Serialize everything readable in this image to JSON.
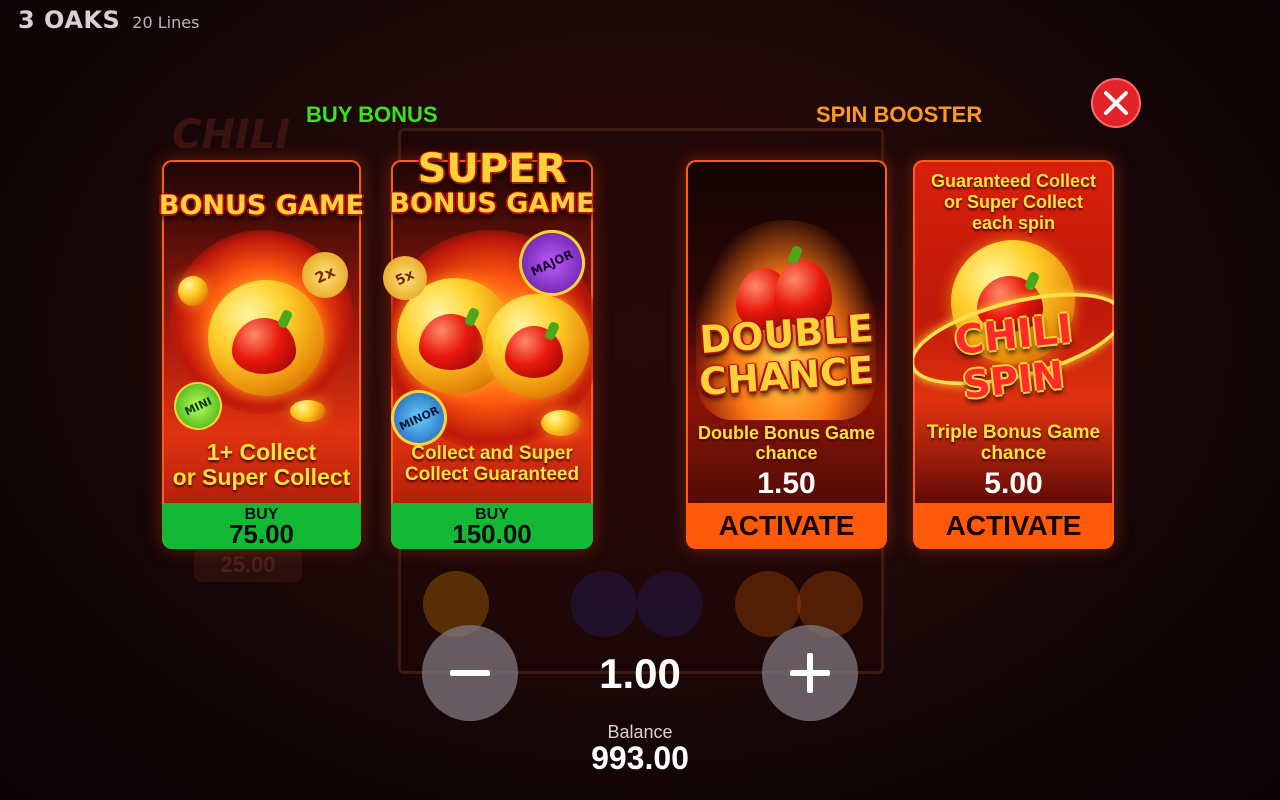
{
  "header": {
    "brand": "3 OAKS",
    "lines": "20 Lines"
  },
  "background": {
    "logo_text": "CHILI",
    "bet_hint": "25.00"
  },
  "sections": {
    "buy_bonus": "BUY BONUS",
    "spin_booster": "SPIN BOOSTER"
  },
  "cards": [
    {
      "title": "BONUS GAME",
      "description": [
        "1+ Collect",
        "or Super Collect"
      ],
      "buy_label": "BUY",
      "price": "75.00",
      "badges": [
        "2x",
        "MINI"
      ]
    },
    {
      "title_line1": "SUPER",
      "title_line2": "BONUS GAME",
      "description": [
        "Collect and Super",
        "Collect Guaranteed"
      ],
      "buy_label": "BUY",
      "price": "150.00",
      "badges": [
        "5x",
        "MAJOR",
        "MINOR"
      ]
    },
    {
      "art_line1": "DOUBLE",
      "art_line2": "CHANCE",
      "description": [
        "Double Bonus Game",
        "chance"
      ],
      "multiplier": "1.50",
      "action": "ACTIVATE"
    },
    {
      "header": [
        "Guaranteed Collect",
        "or Super Collect",
        "each spin"
      ],
      "art_line1": "CHILI",
      "art_line2": "SPIN",
      "description": [
        "Triple Bonus Game",
        "chance"
      ],
      "multiplier": "5.00",
      "action": "ACTIVATE"
    }
  ],
  "bet": {
    "value": "1.00"
  },
  "balance": {
    "label": "Balance",
    "value": "993.00"
  },
  "colors": {
    "buy_title": "#3de21e",
    "spin_title": "#ff9a1c",
    "buy_button": "#13b935",
    "activate_button": "#ff5a0a",
    "close_button": "#e2232a"
  },
  "icons": {
    "close": "close-icon",
    "minus": "minus-icon",
    "plus": "plus-icon"
  }
}
